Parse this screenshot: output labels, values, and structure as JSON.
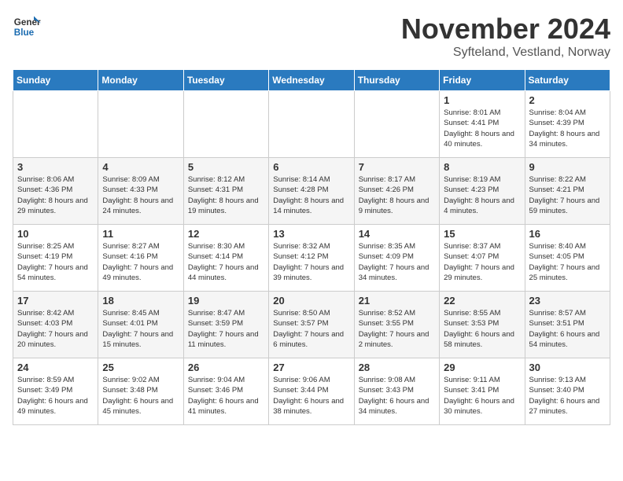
{
  "logo": {
    "line1": "General",
    "line2": "Blue"
  },
  "title": "November 2024",
  "location": "Syfteland, Vestland, Norway",
  "days_of_week": [
    "Sunday",
    "Monday",
    "Tuesday",
    "Wednesday",
    "Thursday",
    "Friday",
    "Saturday"
  ],
  "weeks": [
    [
      {
        "day": "",
        "info": ""
      },
      {
        "day": "",
        "info": ""
      },
      {
        "day": "",
        "info": ""
      },
      {
        "day": "",
        "info": ""
      },
      {
        "day": "",
        "info": ""
      },
      {
        "day": "1",
        "info": "Sunrise: 8:01 AM\nSunset: 4:41 PM\nDaylight: 8 hours and 40 minutes."
      },
      {
        "day": "2",
        "info": "Sunrise: 8:04 AM\nSunset: 4:39 PM\nDaylight: 8 hours and 34 minutes."
      }
    ],
    [
      {
        "day": "3",
        "info": "Sunrise: 8:06 AM\nSunset: 4:36 PM\nDaylight: 8 hours and 29 minutes."
      },
      {
        "day": "4",
        "info": "Sunrise: 8:09 AM\nSunset: 4:33 PM\nDaylight: 8 hours and 24 minutes."
      },
      {
        "day": "5",
        "info": "Sunrise: 8:12 AM\nSunset: 4:31 PM\nDaylight: 8 hours and 19 minutes."
      },
      {
        "day": "6",
        "info": "Sunrise: 8:14 AM\nSunset: 4:28 PM\nDaylight: 8 hours and 14 minutes."
      },
      {
        "day": "7",
        "info": "Sunrise: 8:17 AM\nSunset: 4:26 PM\nDaylight: 8 hours and 9 minutes."
      },
      {
        "day": "8",
        "info": "Sunrise: 8:19 AM\nSunset: 4:23 PM\nDaylight: 8 hours and 4 minutes."
      },
      {
        "day": "9",
        "info": "Sunrise: 8:22 AM\nSunset: 4:21 PM\nDaylight: 7 hours and 59 minutes."
      }
    ],
    [
      {
        "day": "10",
        "info": "Sunrise: 8:25 AM\nSunset: 4:19 PM\nDaylight: 7 hours and 54 minutes."
      },
      {
        "day": "11",
        "info": "Sunrise: 8:27 AM\nSunset: 4:16 PM\nDaylight: 7 hours and 49 minutes."
      },
      {
        "day": "12",
        "info": "Sunrise: 8:30 AM\nSunset: 4:14 PM\nDaylight: 7 hours and 44 minutes."
      },
      {
        "day": "13",
        "info": "Sunrise: 8:32 AM\nSunset: 4:12 PM\nDaylight: 7 hours and 39 minutes."
      },
      {
        "day": "14",
        "info": "Sunrise: 8:35 AM\nSunset: 4:09 PM\nDaylight: 7 hours and 34 minutes."
      },
      {
        "day": "15",
        "info": "Sunrise: 8:37 AM\nSunset: 4:07 PM\nDaylight: 7 hours and 29 minutes."
      },
      {
        "day": "16",
        "info": "Sunrise: 8:40 AM\nSunset: 4:05 PM\nDaylight: 7 hours and 25 minutes."
      }
    ],
    [
      {
        "day": "17",
        "info": "Sunrise: 8:42 AM\nSunset: 4:03 PM\nDaylight: 7 hours and 20 minutes."
      },
      {
        "day": "18",
        "info": "Sunrise: 8:45 AM\nSunset: 4:01 PM\nDaylight: 7 hours and 15 minutes."
      },
      {
        "day": "19",
        "info": "Sunrise: 8:47 AM\nSunset: 3:59 PM\nDaylight: 7 hours and 11 minutes."
      },
      {
        "day": "20",
        "info": "Sunrise: 8:50 AM\nSunset: 3:57 PM\nDaylight: 7 hours and 6 minutes."
      },
      {
        "day": "21",
        "info": "Sunrise: 8:52 AM\nSunset: 3:55 PM\nDaylight: 7 hours and 2 minutes."
      },
      {
        "day": "22",
        "info": "Sunrise: 8:55 AM\nSunset: 3:53 PM\nDaylight: 6 hours and 58 minutes."
      },
      {
        "day": "23",
        "info": "Sunrise: 8:57 AM\nSunset: 3:51 PM\nDaylight: 6 hours and 54 minutes."
      }
    ],
    [
      {
        "day": "24",
        "info": "Sunrise: 8:59 AM\nSunset: 3:49 PM\nDaylight: 6 hours and 49 minutes."
      },
      {
        "day": "25",
        "info": "Sunrise: 9:02 AM\nSunset: 3:48 PM\nDaylight: 6 hours and 45 minutes."
      },
      {
        "day": "26",
        "info": "Sunrise: 9:04 AM\nSunset: 3:46 PM\nDaylight: 6 hours and 41 minutes."
      },
      {
        "day": "27",
        "info": "Sunrise: 9:06 AM\nSunset: 3:44 PM\nDaylight: 6 hours and 38 minutes."
      },
      {
        "day": "28",
        "info": "Sunrise: 9:08 AM\nSunset: 3:43 PM\nDaylight: 6 hours and 34 minutes."
      },
      {
        "day": "29",
        "info": "Sunrise: 9:11 AM\nSunset: 3:41 PM\nDaylight: 6 hours and 30 minutes."
      },
      {
        "day": "30",
        "info": "Sunrise: 9:13 AM\nSunset: 3:40 PM\nDaylight: 6 hours and 27 minutes."
      }
    ]
  ]
}
